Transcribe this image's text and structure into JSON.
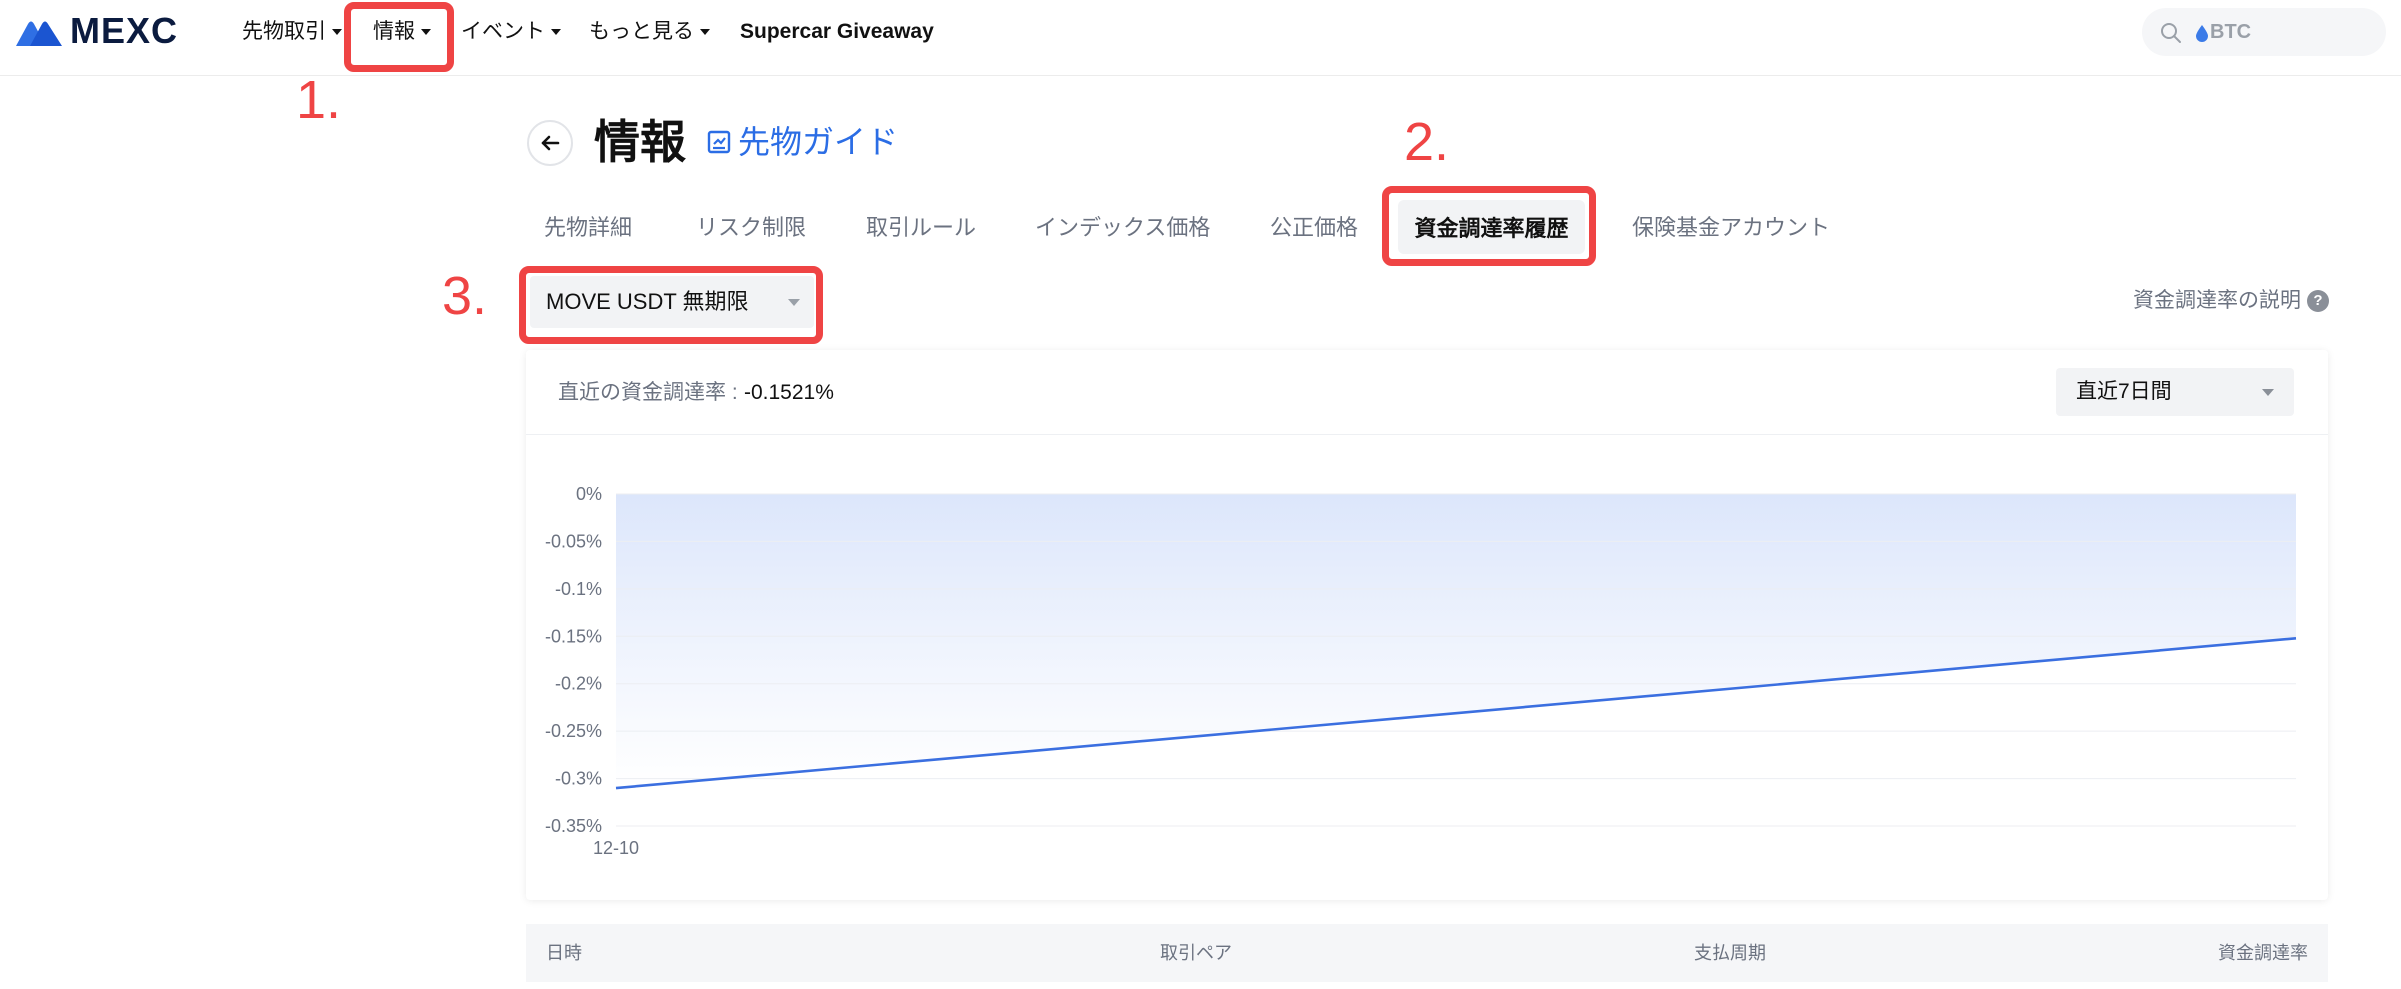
{
  "nav": {
    "logo": "MEXC",
    "items": [
      {
        "label": "先物取引",
        "caret": true
      },
      {
        "label": "情報",
        "caret": true
      },
      {
        "label": "イベント",
        "caret": true
      },
      {
        "label": "もっと見る",
        "caret": true
      },
      {
        "label": "Supercar Giveaway",
        "caret": false
      }
    ],
    "search_placeholder": "BTC"
  },
  "annotations": [
    "1.",
    "2.",
    "3."
  ],
  "page": {
    "title": "情報",
    "guide_link": "先物ガイド"
  },
  "tabs": [
    "先物詳細",
    "リスク制限",
    "取引ルール",
    "インデックス価格",
    "公正価格",
    "資金調達率履歴",
    "保険基金アカウント"
  ],
  "active_tab": "資金調達率履歴",
  "contract_select": "MOVE USDT 無期限",
  "explain_link": "資金調達率の説明",
  "card": {
    "rate_label": "直近の資金調達率 :",
    "rate_value": "-0.1521%",
    "range_select": "直近7日間"
  },
  "colors": {
    "accent": "#2b6de5",
    "line": "#3b6fe0",
    "annotation": "#ef4444"
  },
  "chart_data": {
    "type": "area",
    "x": [
      "12-10",
      ""
    ],
    "series": [
      {
        "values": [
          -0.31,
          -0.1521
        ]
      }
    ],
    "y_ticks": [
      "0%",
      "-0.05%",
      "-0.1%",
      "-0.15%",
      "-0.2%",
      "-0.25%",
      "-0.3%",
      "-0.35%"
    ],
    "ylim": [
      -0.35,
      0
    ],
    "grid": true
  },
  "table": {
    "headers": [
      "日時",
      "取引ペア",
      "支払周期",
      "資金調達率"
    ]
  }
}
